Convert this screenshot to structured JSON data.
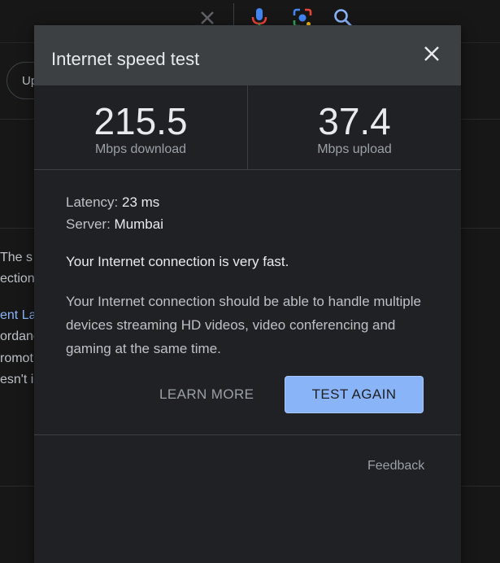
{
  "background_page": {
    "chip_text": "Up",
    "snippet_lines": [
      "The s",
      "ection",
      "ent La",
      "ordanc",
      "romot",
      "esn't i"
    ]
  },
  "dialog": {
    "title": "Internet speed test",
    "download": {
      "value": "215.5",
      "unit": "Mbps download"
    },
    "upload": {
      "value": "37.4",
      "unit": "Mbps upload"
    },
    "latency": {
      "label": "Latency:",
      "value": "23 ms"
    },
    "server": {
      "label": "Server:",
      "value": "Mumbai"
    },
    "summary": "Your Internet connection is very fast.",
    "description": "Your Internet connection should be able to handle multiple devices streaming HD videos, video conferencing and gaming at the same time.",
    "learn_more_label": "LEARN MORE",
    "test_again_label": "TEST AGAIN",
    "feedback_label": "Feedback"
  },
  "icons": {
    "close": "close-icon",
    "clear": "clear-icon",
    "mic": "microphone-icon",
    "lens": "lens-icon",
    "search": "search-icon"
  },
  "colors": {
    "dialog_bg": "#202124",
    "header_bg": "#3c4043",
    "accent_button": "#8ab4f8",
    "text_primary": "#e8eaed",
    "text_secondary": "#9aa0a6",
    "link": "#8ab4f8"
  }
}
